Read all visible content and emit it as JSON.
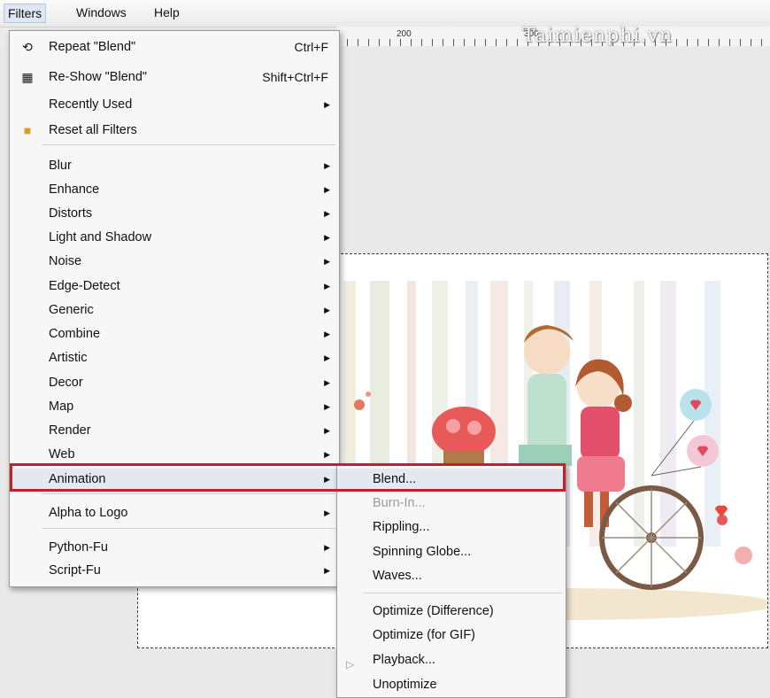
{
  "menubar": {
    "filters": "Filters",
    "windows": "Windows",
    "help": "Help"
  },
  "ruler": {
    "label_200": "200",
    "label_300": "300"
  },
  "watermark": "Taimienphi.vn",
  "filters_menu": {
    "repeat_label": "Repeat \"Blend\"",
    "repeat_shortcut": "Ctrl+F",
    "reshow_label": "Re-Show \"Blend\"",
    "reshow_shortcut": "Shift+Ctrl+F",
    "recently_used": "Recently Used",
    "reset_filters": "Reset all Filters",
    "items": [
      "Blur",
      "Enhance",
      "Distorts",
      "Light and Shadow",
      "Noise",
      "Edge-Detect",
      "Generic",
      "Combine",
      "Artistic",
      "Decor",
      "Map",
      "Render",
      "Web"
    ],
    "animation": "Animation",
    "alpha_to_logo": "Alpha to Logo",
    "python_fu": "Python-Fu",
    "script_fu": "Script-Fu"
  },
  "animation_menu": {
    "blend": "Blend...",
    "burn_in": "Burn-In...",
    "rippling": "Rippling...",
    "spinning_globe": "Spinning Globe...",
    "waves": "Waves...",
    "optimize_difference": "Optimize (Difference)",
    "optimize_gif": "Optimize (for GIF)",
    "playback": "Playback...",
    "unoptimize": "Unoptimize"
  },
  "colors": {
    "highlight_border": "#c81e28",
    "menu_bg": "#f7f7f7"
  },
  "icons": [
    "repeat-icon",
    "reshow-icon",
    "reset-icon",
    "play-icon",
    "submenu-arrow-icon"
  ]
}
